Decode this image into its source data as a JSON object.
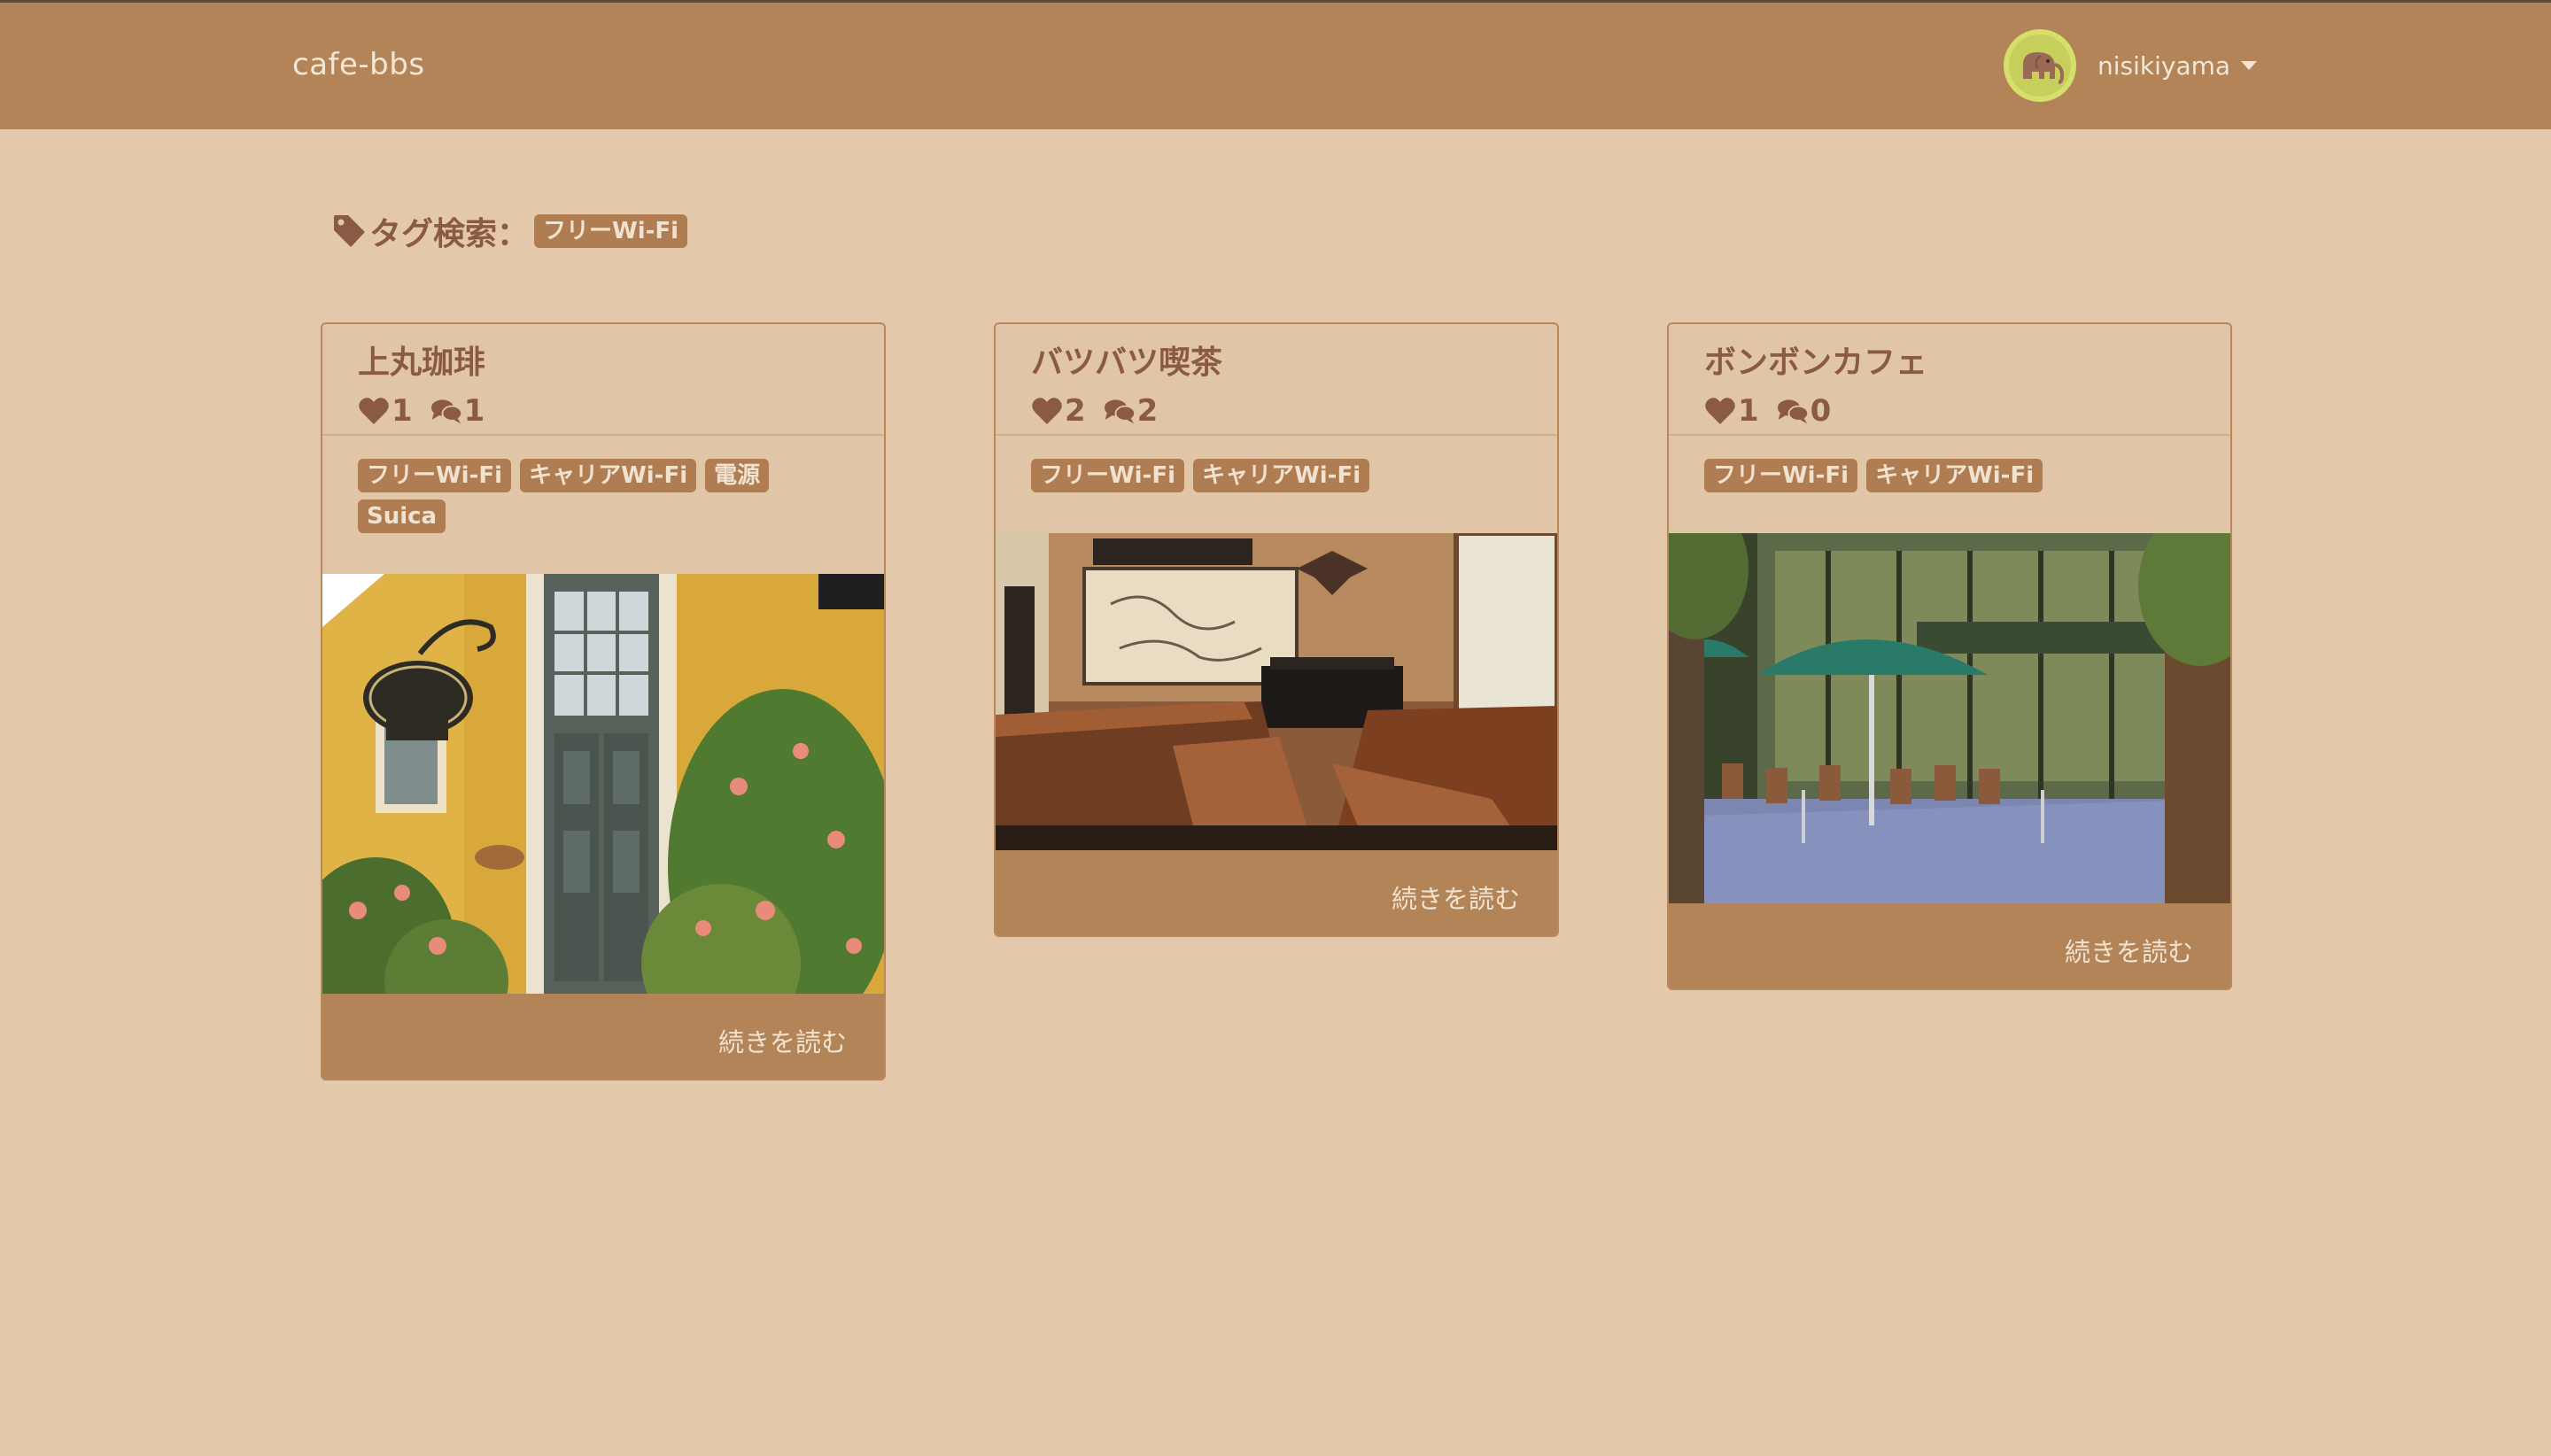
{
  "navbar": {
    "brand": "cafe-bbs",
    "username": "nisikiyama"
  },
  "search": {
    "label": "タグ検索：",
    "tag": "フリーWi-Fi"
  },
  "cards": [
    {
      "title": "上丸珈琲",
      "likes": "1",
      "comments": "1",
      "tags": [
        "フリーWi-Fi",
        "キャリアWi-Fi",
        "電源",
        "Suica"
      ],
      "read_more": "続きを読む"
    },
    {
      "title": "バツバツ喫茶",
      "likes": "2",
      "comments": "2",
      "tags": [
        "フリーWi-Fi",
        "キャリアWi-Fi"
      ],
      "read_more": "続きを読む"
    },
    {
      "title": "ボンボンカフェ",
      "likes": "1",
      "comments": "0",
      "tags": [
        "フリーWi-Fi",
        "キャリアWi-Fi"
      ],
      "read_more": "続きを読む"
    }
  ],
  "colors": {
    "background": "#e3c8a9",
    "navbar": "#b38457",
    "text": "#8b5a44",
    "badge": "#b07c52"
  }
}
